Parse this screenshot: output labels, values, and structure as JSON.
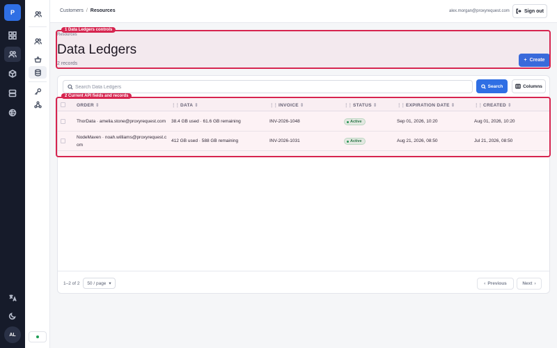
{
  "rail": {
    "logo": "P",
    "items": [
      "dashboard-icon",
      "users-icon",
      "cube-icon",
      "server-icon",
      "globe-icon"
    ],
    "bottom": [
      "translate-icon",
      "moon-icon"
    ],
    "avatar": "AL"
  },
  "sidebar": {
    "items": [
      "users-icon",
      "users-icon",
      "basket-icon",
      "database-icon",
      "key-icon",
      "network-icon"
    ]
  },
  "breadcrumb": {
    "parent": "Customers",
    "separator": "/",
    "current": "Resources"
  },
  "user": {
    "email": "alex.morgan@proxyrequest.com",
    "signout_label": "Sign out"
  },
  "header": {
    "ghost": "Resources",
    "title": "Data Ledgers",
    "records": "2 records",
    "create_label": "Create"
  },
  "toolbar": {
    "search_placeholder": "Search Data Ledgers",
    "search_label": "Search",
    "columns_label": "Columns"
  },
  "table": {
    "columns": [
      "ORDER",
      "DATA",
      "INVOICE",
      "STATUS",
      "EXPIRATION DATE",
      "CREATED"
    ],
    "rows": [
      {
        "order": "ThorData · amelia.stone@proxyrequest.com",
        "data": "38.4 GB used · 61.6 GB remaining",
        "invoice": "INV-2026-1048",
        "status": "Active",
        "expiration": "Sep 01, 2026, 10:20",
        "created": "Aug 01, 2026, 10:20"
      },
      {
        "order_line1": "NodeMaven · noah.williams@proxyrequest.c",
        "order_line2": "om",
        "data": "412 GB used · 588 GB remaining",
        "invoice": "INV-2026-1031",
        "status": "Active",
        "expiration": "Aug 21, 2026, 08:50",
        "created": "Jul 21, 2026, 08:50"
      }
    ]
  },
  "pagination": {
    "range": "1–2 of 2",
    "per_page": "50 / page",
    "prev_label": "Previous",
    "next_label": "Next"
  },
  "annotations": [
    {
      "label": "1 Data Ledgers controls"
    },
    {
      "label": "2 Current API fields and records"
    }
  ],
  "colors": {
    "accent": "#2f6fe4",
    "annotation": "#d6244f",
    "rail": "#161b2a",
    "success": "#1f9d55"
  }
}
